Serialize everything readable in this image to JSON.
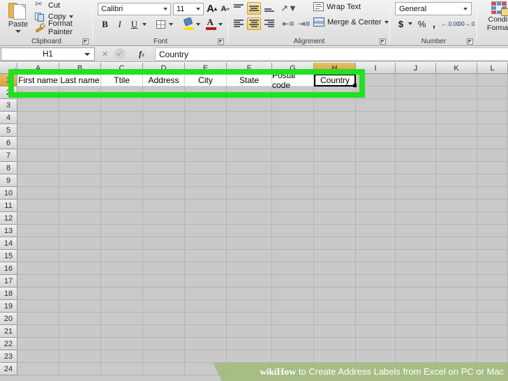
{
  "ribbon": {
    "groups": [
      {
        "label": "Clipboard"
      },
      {
        "label": "Font"
      },
      {
        "label": "Alignment"
      },
      {
        "label": "Number"
      }
    ],
    "clipboard": {
      "paste_label": "Paste",
      "cut_label": "Cut",
      "copy_label": "Copy",
      "format_painter_label": "Format Painter"
    },
    "font": {
      "font_name": "Calibri",
      "font_size": "11",
      "grow_font": "A",
      "shrink_font": "A",
      "bold": "B",
      "italic": "I",
      "underline": "U"
    },
    "alignment": {
      "wrap_text_label": "Wrap Text",
      "merge_center_label": "Merge & Center"
    },
    "number": {
      "format": "General",
      "currency": "$",
      "percent": "%",
      "comma": ",",
      "increase_decimal": ".00",
      "decrease_decimal": ".00"
    },
    "styles": {
      "conditional_formatting_line1": "Conditi",
      "conditional_formatting_line2": "Formatt"
    }
  },
  "formula_bar": {
    "name_box": "H1",
    "fx_label": "fx",
    "formula_value": "Country"
  },
  "sheet": {
    "column_headers": [
      "A",
      "B",
      "C",
      "D",
      "E",
      "F",
      "G",
      "H",
      "I",
      "J",
      "K",
      "L"
    ],
    "active_column": "H",
    "active_row": 1,
    "row_headers": [
      1,
      2,
      3,
      4,
      5,
      6,
      7,
      8,
      9,
      10,
      11,
      12,
      13,
      14,
      15,
      16,
      17,
      18,
      19,
      20,
      21,
      22,
      23,
      24
    ],
    "header_row": [
      {
        "col": "A",
        "value": "First name"
      },
      {
        "col": "B",
        "value": "Last name"
      },
      {
        "col": "C",
        "value": "Ttile"
      },
      {
        "col": "D",
        "value": "Address"
      },
      {
        "col": "E",
        "value": "City"
      },
      {
        "col": "F",
        "value": "State"
      },
      {
        "col": "G",
        "value": "Postal code"
      },
      {
        "col": "H",
        "value": "Country"
      }
    ],
    "selected_cell": "H1"
  },
  "annotation": {
    "color": "#22e022"
  },
  "watermark": {
    "brand_wiki": "wiki",
    "brand_how": "How",
    "text": " to Create Address Labels from Excel on PC or Mac"
  }
}
